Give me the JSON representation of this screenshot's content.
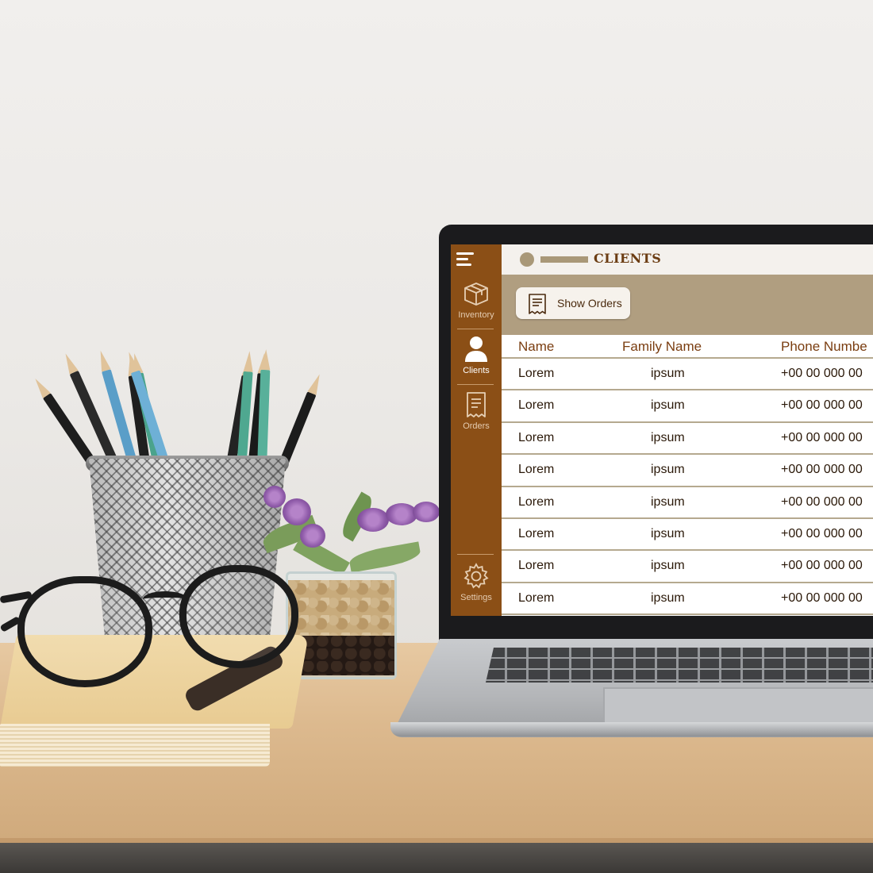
{
  "app": {
    "title": "CLIENTS",
    "sidebar": {
      "items": [
        {
          "label": "Inventory",
          "icon": "box-icon",
          "active": false
        },
        {
          "label": "Clients",
          "icon": "user-icon",
          "active": true
        },
        {
          "label": "Orders",
          "icon": "receipt-icon",
          "active": false
        }
      ],
      "settings": {
        "label": "Settings",
        "icon": "gear-icon"
      }
    },
    "toolbar": {
      "show_orders_label": "Show Orders"
    },
    "table": {
      "columns": [
        "Name",
        "Family Name",
        "Phone Numbe"
      ],
      "rows": [
        {
          "name": "Lorem",
          "family": "ipsum",
          "phone": "+00 00 000 00"
        },
        {
          "name": "Lorem",
          "family": "ipsum",
          "phone": "+00 00 000 00"
        },
        {
          "name": "Lorem",
          "family": "ipsum",
          "phone": "+00 00 000 00"
        },
        {
          "name": "Lorem",
          "family": "ipsum",
          "phone": "+00 00 000 00"
        },
        {
          "name": "Lorem",
          "family": "ipsum",
          "phone": "+00 00 000 00"
        },
        {
          "name": "Lorem",
          "family": "ipsum",
          "phone": "+00 00 000 00"
        },
        {
          "name": "Lorem",
          "family": "ipsum",
          "phone": "+00 00 000 00"
        },
        {
          "name": "Lorem",
          "family": "ipsum",
          "phone": "+00 00 000 00"
        }
      ]
    },
    "colors": {
      "sidebar": "#8b4f16",
      "toolbar": "#b09e80",
      "topbar": "#f4f1ed",
      "accent_text": "#7a3d10"
    }
  }
}
